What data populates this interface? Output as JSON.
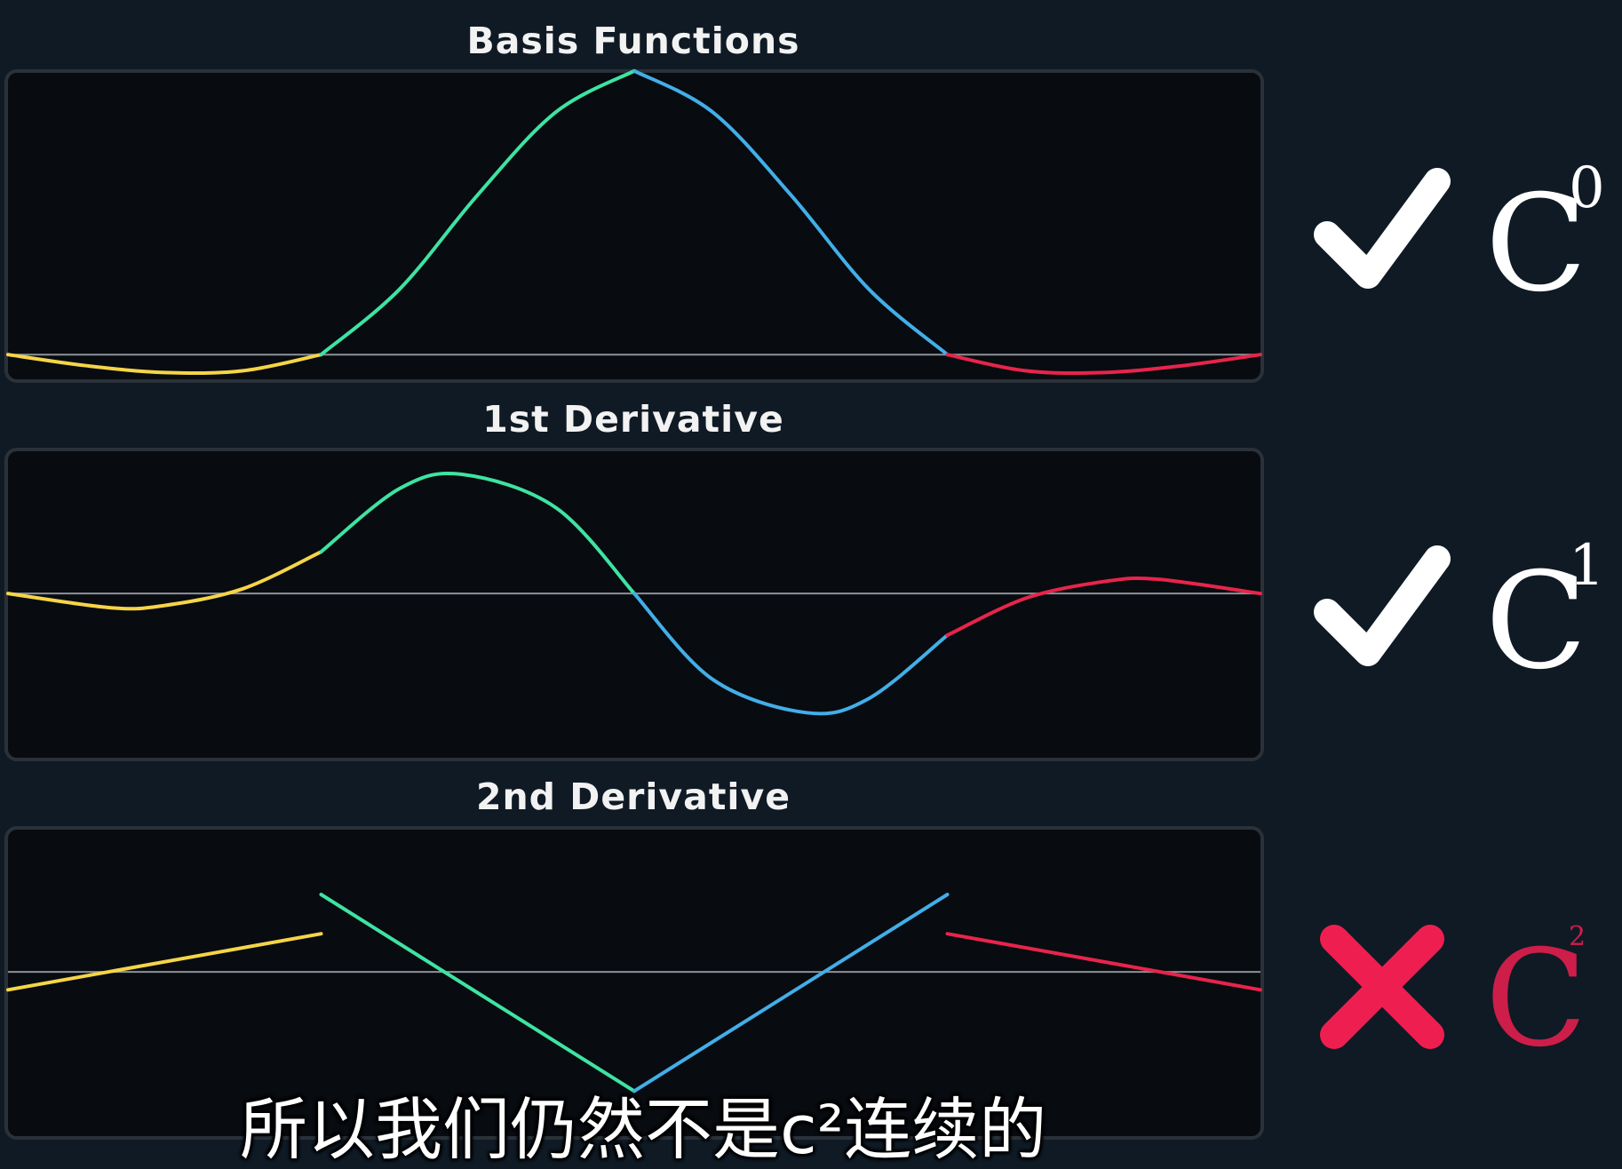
{
  "chart_data": [
    {
      "type": "line",
      "title": "Basis Functions",
      "xlabel": "",
      "ylabel": "",
      "xlim": [
        0,
        4
      ],
      "ylim": [
        -0.1,
        1.0
      ],
      "baseline": 0,
      "grid": false,
      "series": [
        {
          "segment": 0,
          "color": "#f5d547",
          "x": [
            0,
            0.25,
            0.5,
            0.75,
            1.0
          ],
          "y": [
            0,
            -0.039,
            -0.063,
            -0.057,
            0
          ]
        },
        {
          "segment": 1,
          "color": "#3ee3a2",
          "x": [
            1.0,
            1.25,
            1.5,
            1.75,
            2.0
          ],
          "y": [
            0,
            0.23,
            0.563,
            0.855,
            1.0
          ]
        },
        {
          "segment": 2,
          "color": "#42aee8",
          "x": [
            2.0,
            2.25,
            2.5,
            2.75,
            3.0
          ],
          "y": [
            1.0,
            0.855,
            0.563,
            0.23,
            0
          ]
        },
        {
          "segment": 3,
          "color": "#e8244c",
          "x": [
            3.0,
            3.25,
            3.5,
            3.75,
            4.0
          ],
          "y": [
            0,
            -0.057,
            -0.063,
            -0.039,
            0
          ]
        }
      ]
    },
    {
      "type": "line",
      "title": "1st Derivative",
      "xlabel": "",
      "ylabel": "",
      "xlim": [
        0,
        4
      ],
      "ylim": [
        -1.0,
        1.0
      ],
      "baseline": 0,
      "grid": false,
      "series": [
        {
          "segment": 0,
          "color": "#f5d547",
          "x": [
            0,
            0.33,
            0.5,
            0.75,
            1.0
          ],
          "y": [
            0,
            -0.12,
            -0.1,
            0.04,
            0.35
          ]
        },
        {
          "segment": 1,
          "color": "#3ee3a2",
          "x": [
            1.0,
            1.25,
            1.45,
            1.75,
            2.0
          ],
          "y": [
            0.35,
            0.88,
            1.0,
            0.72,
            0
          ]
        },
        {
          "segment": 2,
          "color": "#42aee8",
          "x": [
            2.0,
            2.25,
            2.55,
            2.75,
            3.0
          ],
          "y": [
            0,
            -0.72,
            -1.0,
            -0.88,
            -0.35
          ]
        },
        {
          "segment": 3,
          "color": "#e8244c",
          "x": [
            3.0,
            3.25,
            3.5,
            3.67,
            4.0
          ],
          "y": [
            -0.35,
            -0.04,
            0.1,
            0.12,
            0
          ]
        }
      ]
    },
    {
      "type": "line",
      "title": "2nd Derivative",
      "xlabel": "",
      "ylabel": "",
      "xlim": [
        0,
        4
      ],
      "ylim": [
        -1.0,
        1.0
      ],
      "baseline": 0,
      "grid": false,
      "series": [
        {
          "segment": 0,
          "color": "#f5d547",
          "x": [
            0,
            1.0
          ],
          "y": [
            -0.15,
            0.32
          ]
        },
        {
          "segment": 1,
          "color": "#3ee3a2",
          "x": [
            1.0,
            2.0
          ],
          "y": [
            0.65,
            -1.0
          ]
        },
        {
          "segment": 2,
          "color": "#42aee8",
          "x": [
            2.0,
            3.0
          ],
          "y": [
            -1.0,
            0.65
          ]
        },
        {
          "segment": 3,
          "color": "#e8244c",
          "x": [
            3.0,
            4.0
          ],
          "y": [
            0.32,
            -0.15
          ]
        }
      ]
    }
  ],
  "continuity": [
    {
      "symbol": "C",
      "order": "0",
      "status": "check",
      "color": "#ffffff"
    },
    {
      "symbol": "C",
      "order": "1",
      "status": "check",
      "color": "#ffffff"
    },
    {
      "symbol": "C",
      "order": "2",
      "status": "cross",
      "color": "#ee1f50"
    }
  ],
  "colors": {
    "background": "#0f1a25",
    "panel": "#080b10",
    "panel_border": "#2b3138",
    "baseline": "#8d9299",
    "check": "#ffffff",
    "cross": "#ee1f50"
  },
  "icons": {
    "check": "check-icon",
    "cross": "cross-icon"
  },
  "subtitle": "所以我们仍然不是c²连续的"
}
